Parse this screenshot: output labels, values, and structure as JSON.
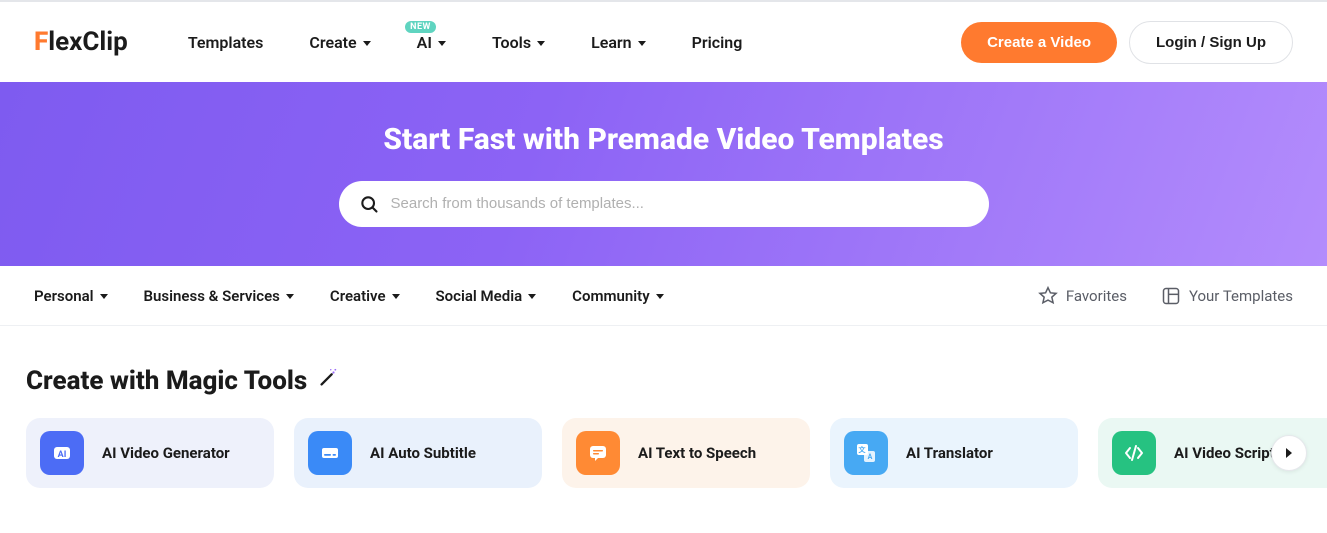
{
  "logo": {
    "text": "lexClip"
  },
  "nav": {
    "templates": "Templates",
    "create": "Create",
    "ai": "AI",
    "ai_badge": "NEW",
    "tools": "Tools",
    "learn": "Learn",
    "pricing": "Pricing"
  },
  "header_buttons": {
    "create_video": "Create a Video",
    "login_signup": "Login / Sign Up"
  },
  "hero": {
    "title": "Start Fast with Premade Video Templates",
    "search_placeholder": "Search from thousands of templates..."
  },
  "categories": {
    "personal": "Personal",
    "business": "Business & Services",
    "creative": "Creative",
    "social": "Social Media",
    "community": "Community",
    "favorites": "Favorites",
    "your_templates": "Your Templates"
  },
  "section": {
    "title": "Create with Magic Tools"
  },
  "tools": [
    {
      "label": "AI Video Generator",
      "bg": "#eef1fb",
      "icon_bg": "#4c6cf5",
      "icon": "ai"
    },
    {
      "label": "AI Auto Subtitle",
      "bg": "#e9f1fc",
      "icon_bg": "#3a8af7",
      "icon": "subtitle"
    },
    {
      "label": "AI Text to Speech",
      "bg": "#fdf3ea",
      "icon_bg": "#ff8a34",
      "icon": "speech"
    },
    {
      "label": "AI Translator",
      "bg": "#eaf4fd",
      "icon_bg": "#47a9f3",
      "icon": "translate"
    },
    {
      "label": "AI Video Script",
      "bg": "#eaf8f3",
      "icon_bg": "#26c281",
      "icon": "script"
    }
  ]
}
